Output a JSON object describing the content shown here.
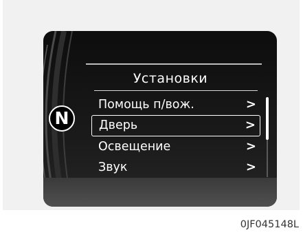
{
  "screen": {
    "title": "Установки",
    "gear_indicator": "N",
    "menu": [
      {
        "label": "Помощь п/вож.",
        "arrow": ">",
        "selected": false
      },
      {
        "label": "Дверь",
        "arrow": ">",
        "selected": true
      },
      {
        "label": "Освещение",
        "arrow": ">",
        "selected": false
      },
      {
        "label": "Звук",
        "arrow": ">",
        "selected": false
      }
    ]
  },
  "figure_code": "0JF045148L",
  "colors": {
    "screen_bg": "#111111",
    "text": "#ffffff",
    "frame_bg": "#f1f1f1"
  }
}
